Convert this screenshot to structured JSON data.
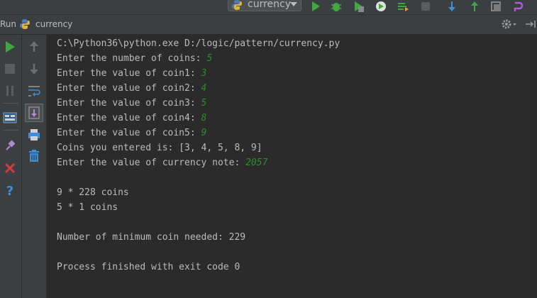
{
  "toolbar": {
    "run_config_label": "currency"
  },
  "run_panel": {
    "run_label": "Run",
    "tab_label": "currency"
  },
  "console": {
    "lines": [
      {
        "text": "C:\\Python36\\python.exe D:/logic/pattern/currency.py",
        "input": ""
      },
      {
        "text": "Enter the number of coins: ",
        "input": "5"
      },
      {
        "text": "Enter the value of coin1: ",
        "input": "3"
      },
      {
        "text": "Enter the value of coin2: ",
        "input": "4"
      },
      {
        "text": "Enter the value of coin3: ",
        "input": "5"
      },
      {
        "text": "Enter the value of coin4: ",
        "input": "8"
      },
      {
        "text": "Enter the value of coin5: ",
        "input": "9"
      },
      {
        "text": "Coins you entered is: [3, 4, 5, 8, 9]",
        "input": ""
      },
      {
        "text": "Enter the value of currency note: ",
        "input": "2057"
      },
      {
        "text": "",
        "input": ""
      },
      {
        "text": "9 * 228 coins",
        "input": ""
      },
      {
        "text": "5 * 1 coins",
        "input": ""
      },
      {
        "text": "",
        "input": ""
      },
      {
        "text": "Number of minimum coin needed: 229",
        "input": ""
      },
      {
        "text": "",
        "input": ""
      },
      {
        "text": "Process finished with exit code 0",
        "input": ""
      }
    ]
  },
  "icons": {
    "toolbar": [
      "python-icon",
      "run-icon",
      "debug-icon",
      "run-with-coverage-icon",
      "profile-icon",
      "concurrency-icon",
      "stop-icon",
      "vcs-update-icon",
      "vcs-commit-icon",
      "history-icon",
      "revert-icon"
    ],
    "side_left": [
      "rerun-icon",
      "stop-icon",
      "pause-icon",
      "restore-layout-icon",
      "pin-tab-icon",
      "close-icon",
      "help-icon"
    ],
    "side_right": [
      "up-stack-icon",
      "down-stack-icon",
      "soft-wrap-icon",
      "scroll-to-end-icon",
      "print-icon",
      "clear-all-icon"
    ]
  },
  "colors": {
    "background": "#2b2b2b",
    "panel": "#3c3f41",
    "text": "#bbbbbb",
    "user_input": "#2e8b2e",
    "run_green": "#3fa83f",
    "close_red": "#d23c3c",
    "help_blue": "#3d8fd6"
  }
}
